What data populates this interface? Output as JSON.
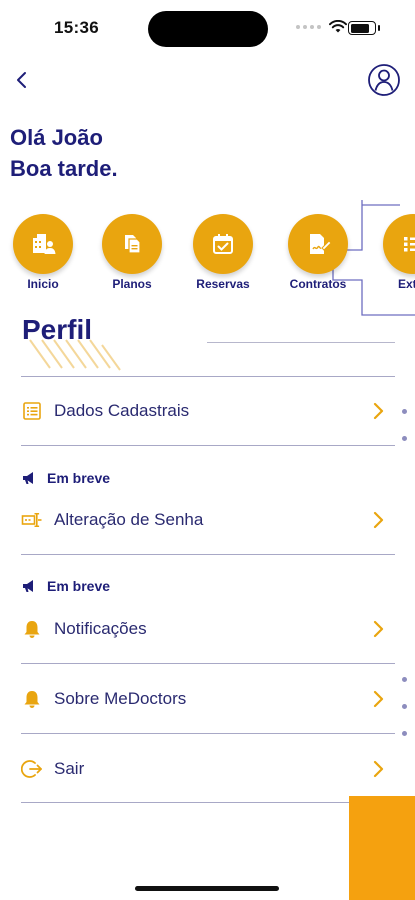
{
  "status_bar": {
    "time": "15:36"
  },
  "greeting": {
    "line1": "Olá João",
    "line2": "Boa tarde."
  },
  "quick_actions": [
    {
      "label": "Inicio",
      "icon": "buildings-user-icon"
    },
    {
      "label": "Planos",
      "icon": "documents-icon"
    },
    {
      "label": "Reservas",
      "icon": "calendar-check-icon"
    },
    {
      "label": "Contratos",
      "icon": "contract-sign-icon"
    },
    {
      "label": "Extra",
      "icon": "list-icon"
    }
  ],
  "profile": {
    "title": "Perfil",
    "soon_label": "Em breve",
    "items": [
      {
        "label": "Dados Cadastrais",
        "icon": "form-list-icon"
      },
      {
        "label": "Alteração de Senha",
        "icon": "password-key-icon"
      },
      {
        "label": "Notificações",
        "icon": "bell-icon"
      },
      {
        "label": "Sobre MeDoctors",
        "icon": "bell-icon"
      },
      {
        "label": "Sair",
        "icon": "logout-icon"
      }
    ]
  },
  "colors": {
    "primary_navy": "#1e1e78",
    "accent_orange": "#e9a50f",
    "divider": "#a8a8c6"
  }
}
